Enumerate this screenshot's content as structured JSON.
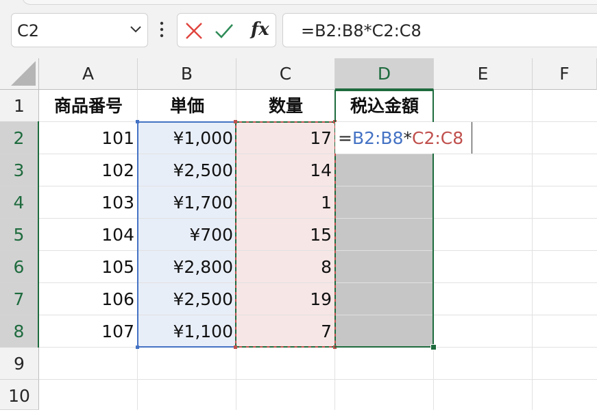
{
  "name_box": {
    "value": "C2"
  },
  "formula_bar": {
    "cancel_icon": "cancel-x-icon",
    "enter_icon": "checkmark-icon",
    "fx_label": "fx",
    "formula": "=B2:B8*C2:C8"
  },
  "columns": [
    "A",
    "B",
    "C",
    "D",
    "E",
    "F"
  ],
  "rows": [
    "1",
    "2",
    "3",
    "4",
    "5",
    "6",
    "7",
    "8",
    "9",
    "10"
  ],
  "headers": {
    "A": "商品番号",
    "B": "単価",
    "C": "数量",
    "D": "税込金額"
  },
  "data": [
    {
      "A": "101",
      "B": "¥1,000",
      "C": "17"
    },
    {
      "A": "102",
      "B": "¥2,500",
      "C": "14"
    },
    {
      "A": "103",
      "B": "¥1,700",
      "C": "1"
    },
    {
      "A": "104",
      "B": "¥700",
      "C": "15"
    },
    {
      "A": "105",
      "B": "¥2,800",
      "C": "8"
    },
    {
      "A": "106",
      "B": "¥2,500",
      "C": "19"
    },
    {
      "A": "107",
      "B": "¥1,100",
      "C": "7"
    }
  ],
  "edit_cell": {
    "eq": "=",
    "ref1": "B2:B8",
    "op": "*",
    "ref2": "C2:C8"
  },
  "colors": {
    "accent": "#1e6b3e",
    "ref1": "#4472c4",
    "ref2": "#c0504d",
    "cancel": "#e0443e",
    "enter": "#2e8b57"
  }
}
